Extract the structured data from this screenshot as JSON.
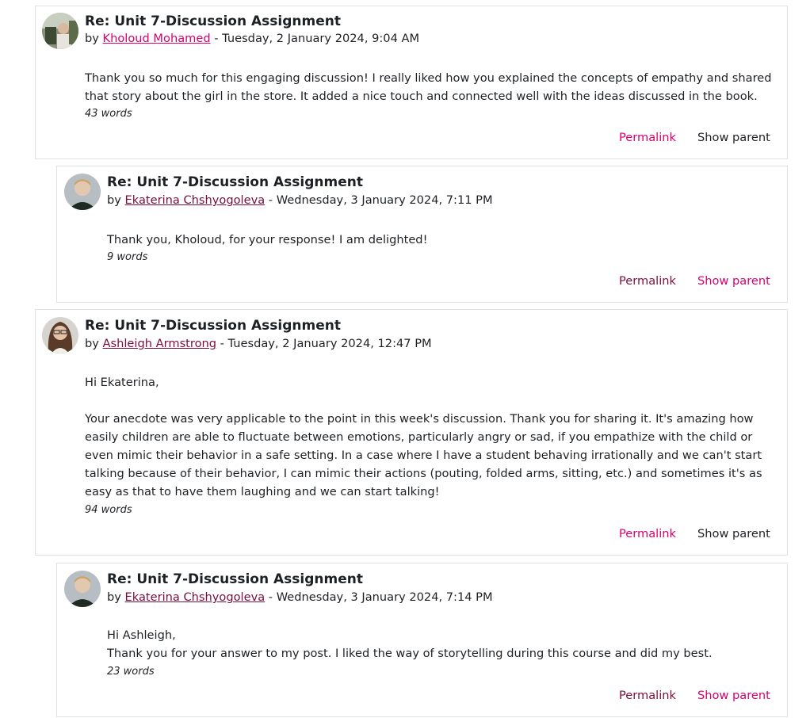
{
  "posts": [
    {
      "subject": "Re: Unit 7-Discussion Assignment",
      "by": "by",
      "author": "Kholoud Mohamed",
      "date": "- Tuesday, 2 January 2024, 9:04 AM",
      "paragraphs": [
        "Thank you so much for this engaging discussion! I really liked how you explained the concepts of empathy and shared that story about the girl in the store. It added a nice touch and connected well with the ideas discussed in the book."
      ],
      "word_count": "43 words",
      "permalink": "Permalink",
      "show_parent": "Show parent",
      "avatar_icon": "user-avatar-photo"
    },
    {
      "subject": "Re: Unit 7-Discussion Assignment",
      "by": "by",
      "author": "Ekaterina Chshyogoleva",
      "date": "- Wednesday, 3 January 2024, 7:11 PM",
      "paragraphs": [
        "Thank you, Kholoud, for your response! I am delighted!"
      ],
      "word_count": "9 words",
      "permalink": "Permalink",
      "show_parent": "Show parent",
      "avatar_icon": "user-avatar-photo"
    },
    {
      "subject": "Re: Unit 7-Discussion Assignment",
      "by": "by",
      "author": "Ashleigh Armstrong",
      "date": "- Tuesday, 2 January 2024, 12:47 PM",
      "paragraphs": [
        "Hi Ekaterina,",
        "Your anecdote was very applicable to the point in this week's discussion. Thank you for sharing it. It's amazing how easily children are able to fluctuate between emotions, particularly angry or sad, if you empathize with the child or even mimic their behavior in a safe setting. In a case where I have a student behaving irrationally and we can't start talking because of their behavior, I can mimic their actions (pouting, folded arms, sitting, etc.) and sometimes it's as easy as that to have them laughing and we can start talking!"
      ],
      "word_count": "94 words",
      "permalink": "Permalink",
      "show_parent": "Show parent",
      "avatar_icon": "user-avatar-photo"
    },
    {
      "subject": "Re: Unit 7-Discussion Assignment",
      "by": "by",
      "author": "Ekaterina Chshyogoleva",
      "date": "- Wednesday, 3 January 2024, 7:14 PM",
      "paragraphs": [
        "Hi Ashleigh,",
        "Thank you for your answer to my post. I liked the way of storytelling during this course and did my best."
      ],
      "word_count": "23 words",
      "permalink": "Permalink",
      "show_parent": "Show parent",
      "avatar_icon": "user-avatar-photo"
    }
  ],
  "colors": {
    "link_pink": "#d6006e",
    "link_dark": "#7a0d3d",
    "text": "#1d2125",
    "border": "#dee2e6"
  }
}
